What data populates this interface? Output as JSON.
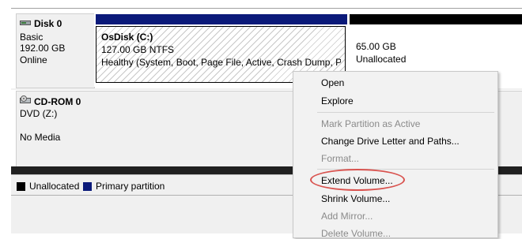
{
  "colors": {
    "primary_partition": "#0b1a7a",
    "unallocated": "#000000",
    "highlight_ring": "#d9534f"
  },
  "disk0": {
    "name": "Disk 0",
    "type": "Basic",
    "size": "192.00 GB",
    "status": "Online",
    "icon": "disk-icon",
    "partition_c": {
      "title": "OsDisk  (C:)",
      "detail": "127.00 GB NTFS",
      "health": "Healthy (System, Boot, Page File, Active, Crash Dump, Primary Partition)"
    },
    "unallocated": {
      "size": "65.00 GB",
      "label": "Unallocated"
    }
  },
  "cdrom0": {
    "name": "CD-ROM 0",
    "type": "DVD (Z:)",
    "status": "No Media",
    "icon": "cdrom-icon"
  },
  "legend": {
    "unallocated_label": "Unallocated",
    "primary_label": "Primary partition"
  },
  "context_menu": {
    "items": [
      {
        "label": "Open",
        "enabled": true
      },
      {
        "label": "Explore",
        "enabled": true
      },
      {
        "label": "Mark Partition as Active",
        "enabled": false
      },
      {
        "label": "Change Drive Letter and Paths...",
        "enabled": true
      },
      {
        "label": "Format...",
        "enabled": false
      },
      {
        "label": "Extend Volume...",
        "enabled": true
      },
      {
        "label": "Shrink Volume...",
        "enabled": true
      },
      {
        "label": "Add Mirror...",
        "enabled": false
      },
      {
        "label": "Delete Volume...",
        "enabled": false
      }
    ]
  }
}
